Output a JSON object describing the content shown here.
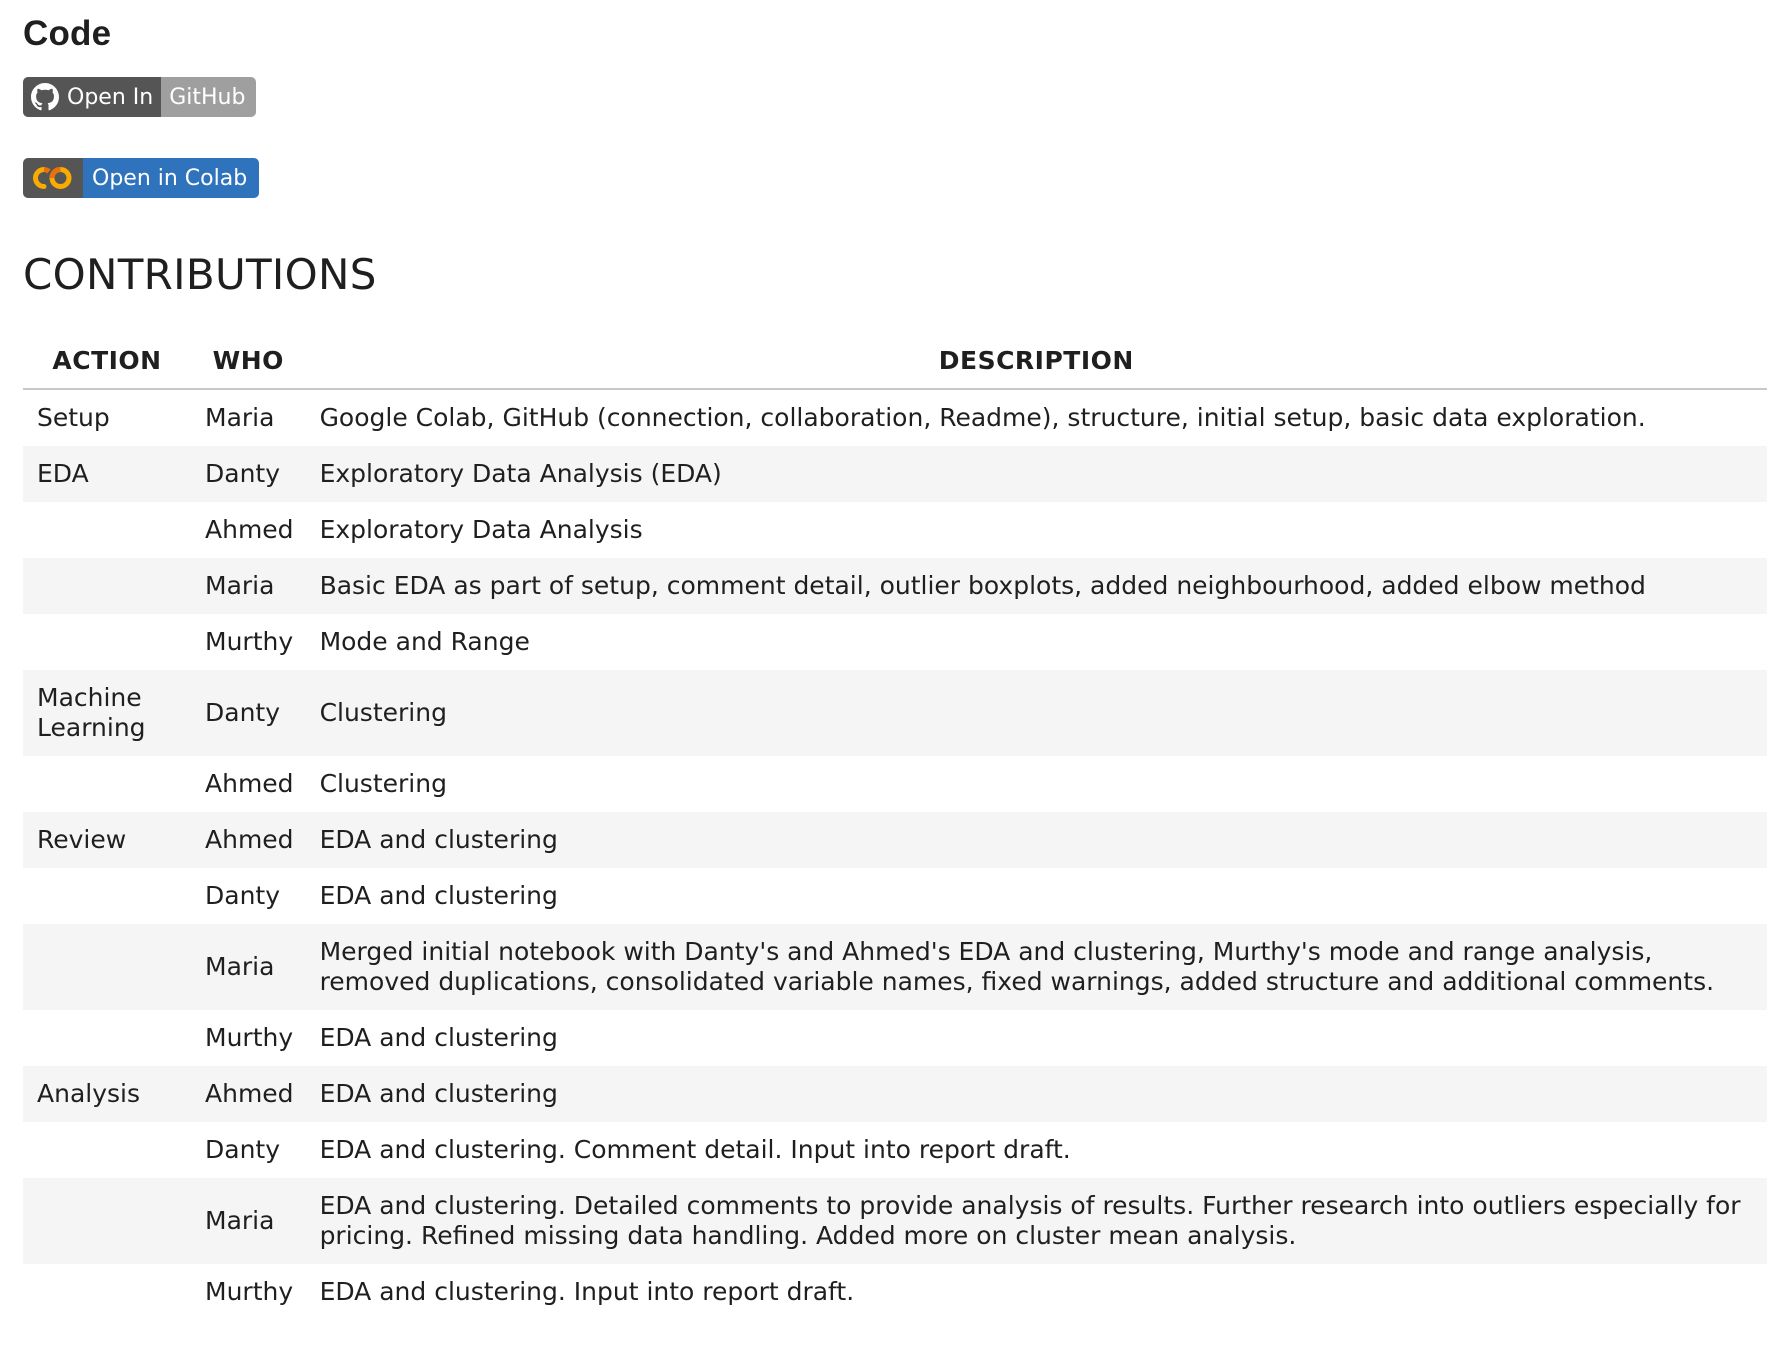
{
  "code_heading": "Code",
  "badges": {
    "github": {
      "left": "Open In",
      "right": "GitHub",
      "icon": "github-icon"
    },
    "colab": {
      "text": "Open in Colab",
      "icon": "colab-icon"
    }
  },
  "colors": {
    "badge_dark": "#555555",
    "badge_github_right": "#9f9f9f",
    "badge_colab_right": "#2f73bc",
    "colab_orange": "#f9ab00",
    "row_stripe": "#f5f5f5"
  },
  "contributions": {
    "title": "CONTRIBUTIONS",
    "headers": {
      "action": "ACTION",
      "who": "WHO",
      "description": "DESCRIPTION"
    },
    "rows": [
      {
        "action": "Setup",
        "who": "Maria",
        "description": "Google Colab, GitHub (connection, collaboration, Readme), structure, initial setup, basic data exploration."
      },
      {
        "action": "EDA",
        "who": "Danty",
        "description": "Exploratory Data Analysis (EDA)"
      },
      {
        "action": "",
        "who": "Ahmed",
        "description": "Exploratory Data Analysis"
      },
      {
        "action": "",
        "who": "Maria",
        "description": "Basic EDA as part of setup, comment detail, outlier boxplots, added neighbourhood, added elbow method"
      },
      {
        "action": "",
        "who": "Murthy",
        "description": "Mode and Range"
      },
      {
        "action": "Machine Learning",
        "who": "Danty",
        "description": "Clustering"
      },
      {
        "action": "",
        "who": "Ahmed",
        "description": "Clustering"
      },
      {
        "action": "Review",
        "who": "Ahmed",
        "description": "EDA and clustering"
      },
      {
        "action": "",
        "who": "Danty",
        "description": "EDA and clustering"
      },
      {
        "action": "",
        "who": "Maria",
        "description": "Merged initial notebook with Danty's and Ahmed's EDA and clustering, Murthy's mode and range analysis, removed duplications, consolidated variable names, fixed warnings, added structure and additional comments."
      },
      {
        "action": "",
        "who": "Murthy",
        "description": "EDA and clustering"
      },
      {
        "action": "Analysis",
        "who": "Ahmed",
        "description": "EDA and clustering"
      },
      {
        "action": "",
        "who": "Danty",
        "description": "EDA and clustering. Comment detail. Input into report draft."
      },
      {
        "action": "",
        "who": "Maria",
        "description": "EDA and clustering. Detailed comments to provide analysis of results. Further research into outliers especially for pricing. Refined missing data handling. Added more on cluster mean analysis."
      },
      {
        "action": "",
        "who": "Murthy",
        "description": "EDA and clustering. Input into report draft."
      }
    ]
  }
}
